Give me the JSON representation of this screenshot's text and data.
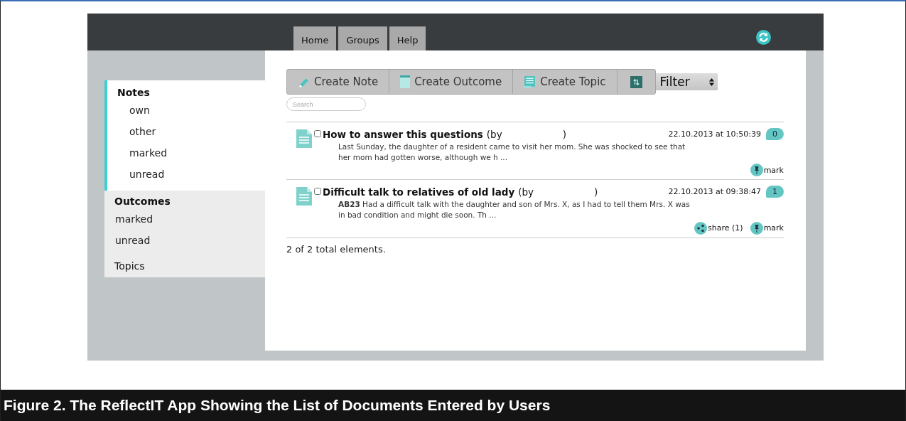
{
  "tabs": [
    {
      "label": "Home"
    },
    {
      "label": "Groups"
    },
    {
      "label": "Help"
    }
  ],
  "toolbar": {
    "buttons": [
      {
        "label": "Create Note",
        "kind": "pencil"
      },
      {
        "label": "Create Outcome",
        "kind": "sheet"
      },
      {
        "label": "Create Topic",
        "kind": "topic"
      }
    ],
    "filter": {
      "value": "Filter"
    }
  },
  "search": {
    "placeholder": "Search"
  },
  "sidebar": {
    "sections": [
      {
        "title": "Notes",
        "selected": true,
        "items": [
          "own",
          "other",
          "marked",
          "unread"
        ]
      },
      {
        "title": "Outcomes",
        "selected": false,
        "items": [
          "marked",
          "unread"
        ]
      },
      {
        "title": "Topics",
        "selected": false
      }
    ]
  },
  "documents": [
    {
      "title": "How to answer this questions",
      "byline_open": "(by",
      "byline_close": ")",
      "checked": false,
      "date": "22.10.2013 at 10:50:39",
      "comments": "0",
      "body": "Last Sunday, the daughter of a resident came to visit her mom. She was shocked to see that her mom had gotten worse, although we h ...",
      "actions": [
        {
          "kind": "mark",
          "label": "mark"
        }
      ]
    },
    {
      "title": "Difficult talk to relatives of old lady",
      "byline_open": "(by",
      "byline_close": ")",
      "checked": false,
      "date": "22.10.2013 at 09:38:47",
      "comments": "1",
      "body": "**AB23** Had a difficult talk with the daughter and son of Mrs. X, as I had to tell them Mrs. X was in bad condition and might die soon. Th ...",
      "actions": [
        {
          "kind": "share",
          "label": "share (1)"
        },
        {
          "kind": "mark",
          "label": "mark"
        }
      ]
    }
  ],
  "footer": "2 of 2 total elements.",
  "caption": "Figure 2. The ReflectIT App Showing the List of Documents Entered by Users"
}
